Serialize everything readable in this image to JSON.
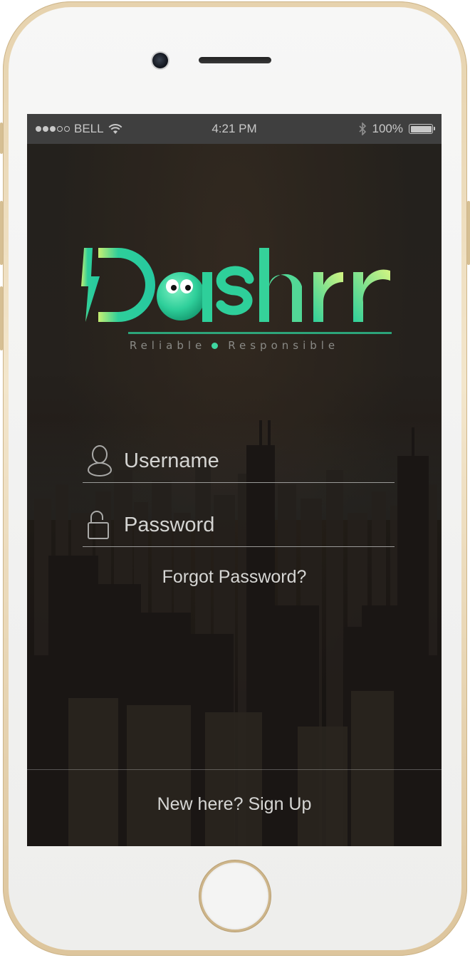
{
  "status_bar": {
    "carrier": "BELL",
    "time": "4:21 PM",
    "battery": "100%",
    "battery_level": 1.0,
    "signal_bars_filled": 3,
    "signal_bars_total": 5
  },
  "logo": {
    "wordmark": "Dashrr",
    "tagline_left": "Reliable",
    "tagline_right": "Responsible",
    "brand_green": "#2ecf9a",
    "brand_lime": "#c8f07a"
  },
  "login": {
    "username_placeholder": "Username",
    "password_placeholder": "Password",
    "forgot_label": "Forgot Password?",
    "signup_label": "New here? Sign Up"
  },
  "icons": {
    "user": "user-icon",
    "lock": "unlocked-padlock-icon",
    "wifi": "wifi-icon",
    "bluetooth": "bluetooth-icon",
    "battery": "battery-icon"
  }
}
